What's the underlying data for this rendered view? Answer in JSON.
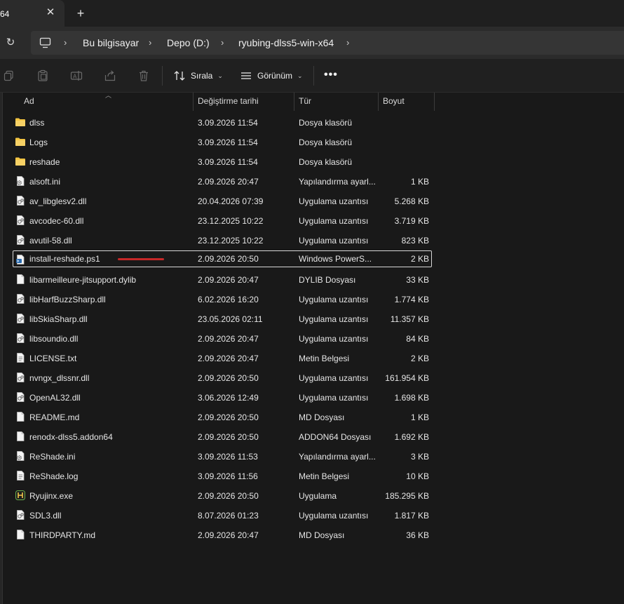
{
  "tab": {
    "title": "64",
    "close_glyph": "✕"
  },
  "new_tab_glyph": "+",
  "address": {
    "refresh_glyph": "↻",
    "separator": "›",
    "crumbs": [
      "Bu bilgisayar",
      "Depo (D:)",
      "ryubing-dlss5-win-x64"
    ]
  },
  "toolbar": {
    "icons": [
      "copy-icon",
      "paste-icon",
      "rename-icon",
      "share-icon",
      "delete-icon"
    ],
    "sort_label": "Sırala",
    "view_label": "Görünüm",
    "more_label": "•••"
  },
  "columns": {
    "name": "Ad",
    "date": "Değiştirme tarihi",
    "type": "Tür",
    "size": "Boyut"
  },
  "files": [
    {
      "name": "dlss",
      "date": "3.09.2026 11:54",
      "type": "Dosya klasörü",
      "size": "",
      "icon": "folder-icon"
    },
    {
      "name": "Logs",
      "date": "3.09.2026 11:54",
      "type": "Dosya klasörü",
      "size": "",
      "icon": "folder-icon"
    },
    {
      "name": "reshade",
      "date": "3.09.2026 11:54",
      "type": "Dosya klasörü",
      "size": "",
      "icon": "folder-icon"
    },
    {
      "name": "alsoft.ini",
      "date": "2.09.2026 20:47",
      "type": "Yapılandırma ayarl...",
      "size": "1 KB",
      "icon": "settings-file-icon"
    },
    {
      "name": "av_libglesv2.dll",
      "date": "20.04.2026 07:39",
      "type": "Uygulama uzantısı",
      "size": "5.268 KB",
      "icon": "dll-file-icon"
    },
    {
      "name": "avcodec-60.dll",
      "date": "23.12.2025 10:22",
      "type": "Uygulama uzantısı",
      "size": "3.719 KB",
      "icon": "dll-file-icon"
    },
    {
      "name": "avutil-58.dll",
      "date": "23.12.2025 10:22",
      "type": "Uygulama uzantısı",
      "size": "823 KB",
      "icon": "dll-file-icon"
    },
    {
      "name": "install-reshade.ps1",
      "date": "2.09.2026 20:50",
      "type": "Windows PowerS...",
      "size": "2 KB",
      "icon": "powershell-file-icon",
      "selected": true
    },
    {
      "name": "libarmeilleure-jitsupport.dylib",
      "date": "2.09.2026 20:47",
      "type": "DYLIB Dosyası",
      "size": "33 KB",
      "icon": "file-icon"
    },
    {
      "name": "libHarfBuzzSharp.dll",
      "date": "6.02.2026 16:20",
      "type": "Uygulama uzantısı",
      "size": "1.774 KB",
      "icon": "dll-file-icon"
    },
    {
      "name": "libSkiaSharp.dll",
      "date": "23.05.2026 02:11",
      "type": "Uygulama uzantısı",
      "size": "11.357 KB",
      "icon": "dll-file-icon"
    },
    {
      "name": "libsoundio.dll",
      "date": "2.09.2026 20:47",
      "type": "Uygulama uzantısı",
      "size": "84 KB",
      "icon": "dll-file-icon"
    },
    {
      "name": "LICENSE.txt",
      "date": "2.09.2026 20:47",
      "type": "Metin Belgesi",
      "size": "2 KB",
      "icon": "text-file-icon"
    },
    {
      "name": "nvngx_dlssnr.dll",
      "date": "2.09.2026 20:50",
      "type": "Uygulama uzantısı",
      "size": "161.954 KB",
      "icon": "dll-file-icon"
    },
    {
      "name": "OpenAL32.dll",
      "date": "3.06.2026 12:49",
      "type": "Uygulama uzantısı",
      "size": "1.698 KB",
      "icon": "dll-file-icon"
    },
    {
      "name": "README.md",
      "date": "2.09.2026 20:50",
      "type": "MD Dosyası",
      "size": "1 KB",
      "icon": "file-icon"
    },
    {
      "name": "renodx-dlss5.addon64",
      "date": "2.09.2026 20:50",
      "type": "ADDON64 Dosyası",
      "size": "1.692 KB",
      "icon": "file-icon"
    },
    {
      "name": "ReShade.ini",
      "date": "3.09.2026 11:53",
      "type": "Yapılandırma ayarl...",
      "size": "3 KB",
      "icon": "settings-file-icon"
    },
    {
      "name": "ReShade.log",
      "date": "3.09.2026 11:56",
      "type": "Metin Belgesi",
      "size": "10 KB",
      "icon": "text-file-icon"
    },
    {
      "name": "Ryujinx.exe",
      "date": "2.09.2026 20:50",
      "type": "Uygulama",
      "size": "185.295 KB",
      "icon": "ryujinx-app-icon"
    },
    {
      "name": "SDL3.dll",
      "date": "8.07.2026 01:23",
      "type": "Uygulama uzantısı",
      "size": "1.817 KB",
      "icon": "dll-file-icon"
    },
    {
      "name": "THIRDPARTY.md",
      "date": "2.09.2026 20:47",
      "type": "MD Dosyası",
      "size": "36 KB",
      "icon": "file-icon"
    }
  ],
  "colors": {
    "folder": "#f4c542",
    "selection_border": "#d8d8d8",
    "annotation_mark": "#c62828",
    "ps1_accent": "#2b6cb0",
    "ryujinx_accent": "#6ab04c"
  }
}
